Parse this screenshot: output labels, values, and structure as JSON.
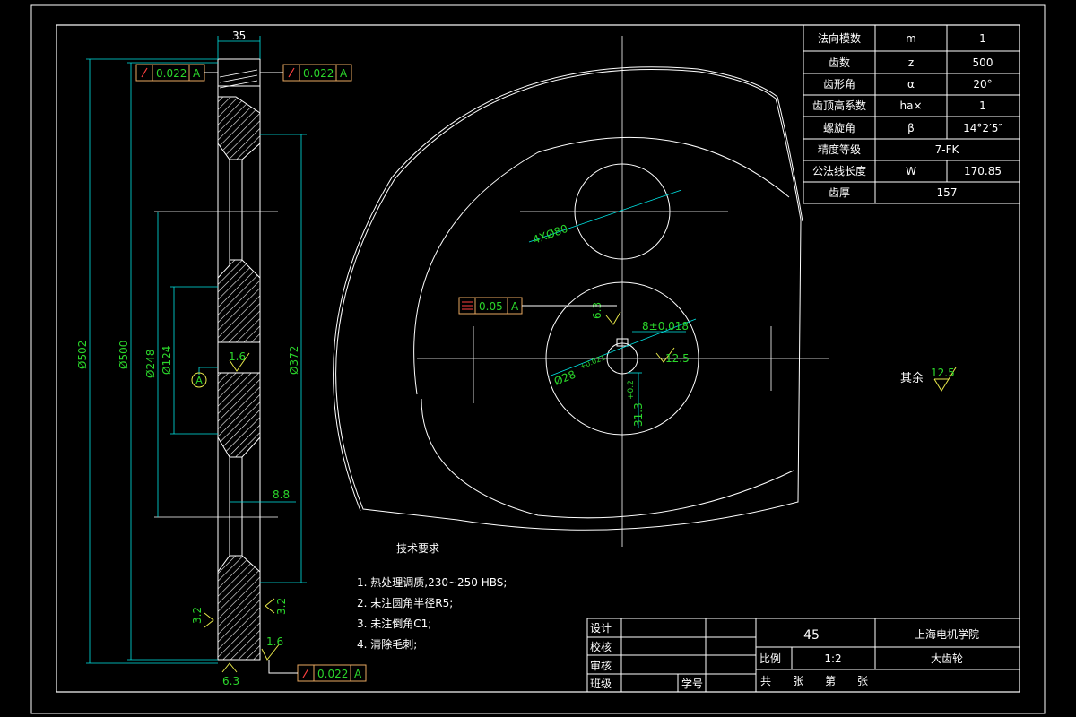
{
  "params_table": {
    "rows": [
      {
        "name": "法向模数",
        "symbol": "m",
        "value": "1"
      },
      {
        "name": "齿数",
        "symbol": "z",
        "value": "500"
      },
      {
        "name": "齿形角",
        "symbol": "α",
        "value": "20°"
      },
      {
        "name": "齿顶高系数",
        "symbol": "ha×",
        "value": "1"
      },
      {
        "name": "螺旋角",
        "symbol": "β",
        "value": "14°2′5″"
      },
      {
        "name": "精度等级",
        "symbol": "",
        "value": "7-FK"
      },
      {
        "name": "公法线长度",
        "symbol": "W",
        "value": "170.85"
      },
      {
        "name": "齿厚",
        "symbol": "",
        "value": "157"
      }
    ]
  },
  "title_block": {
    "design": "设计",
    "check": "校核",
    "review": "审核",
    "class": "班级",
    "student_no": "学号",
    "material": "45",
    "school": "上海电机学院",
    "scale_label": "比例",
    "scale_value": "1:2",
    "part_name": "大齿轮",
    "sheets": "共　　张　　第　　张"
  },
  "tech_req": {
    "title": "技术要求",
    "items": [
      "1. 热处理调质,230~250 HBS;",
      "2. 未注圆角半径R5;",
      "3. 未注倒角C1;",
      "4. 清除毛刺;"
    ]
  },
  "remaining_roughness": {
    "label": "其余",
    "value": "12.5"
  },
  "dims": {
    "width_35": "35",
    "d502": "Ø502",
    "d500": "Ø500",
    "d248": "Ø248",
    "d124": "Ø124",
    "d372": "Ø372",
    "web_88": "8.8",
    "holes": "4XØ80",
    "bore": "Ø28",
    "bore_tol": "+0.021",
    "bore_tol2": "0",
    "keyway": "8±0.018",
    "key_depth": "31.3",
    "key_depth_tol": "+0.2",
    "key_depth_tol2": "0",
    "datum": "A"
  },
  "roughness": {
    "r16_bore": "1.6",
    "r32_left": "3.2",
    "r32_right": "3.2",
    "r16_bottom": "1.6",
    "r63_bottom": "6.3",
    "r63_key": "6.3",
    "r125_key": "12.5"
  },
  "tolerances": {
    "runout_left": {
      "value": "0.022",
      "datum": "A"
    },
    "runout_right": {
      "value": "0.022",
      "datum": "A"
    },
    "runout_bottom": {
      "value": "0.022",
      "datum": "A"
    },
    "symmetry": {
      "value": "0.05",
      "datum": "A"
    }
  }
}
